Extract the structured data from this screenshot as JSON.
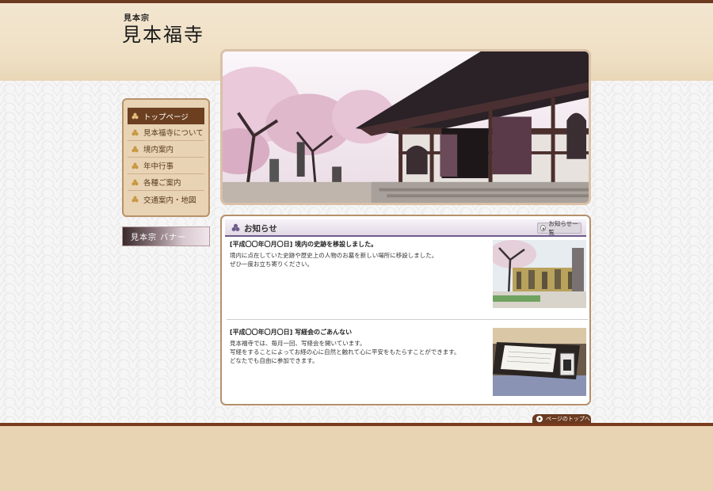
{
  "site": {
    "sub_title": "見本宗",
    "title": "見本福寺"
  },
  "nav": {
    "items": [
      {
        "label": "トップページ",
        "active": true
      },
      {
        "label": "見本福寺について",
        "active": false
      },
      {
        "label": "境内案内",
        "active": false
      },
      {
        "label": "年中行事",
        "active": false
      },
      {
        "label": "各種ご案内",
        "active": false
      },
      {
        "label": "交通案内・地図",
        "active": false
      }
    ]
  },
  "banner": {
    "label": "見本宗 バナー"
  },
  "news": {
    "title": "お知らせ",
    "more_label": "お知らせ一覧",
    "entries": [
      {
        "title": "[平成〇〇年〇月〇日] 境内の史跡を移設しました。",
        "lines": [
          "境内に点在していた史跡や歴史上の人物のお墓を新しい場所に移設しました。",
          "ぜひ一度お立ち寄りください。"
        ]
      },
      {
        "title": "[平成〇〇年〇月〇日] 写経会のごあんない",
        "lines": [
          "見本福寺では、毎月一回、写経会を開いています。",
          "写経をすることによってお経の心に自然と触れて心に平安をもたらすことができます。",
          "どなたでも自由に参加できます。"
        ]
      }
    ]
  },
  "footer": {
    "page_top_label": "ページのトップへ"
  },
  "colors": {
    "brown": "#6b3a1f",
    "accent_purple": "#6d5c8a",
    "beige": "#e8d3b3"
  }
}
